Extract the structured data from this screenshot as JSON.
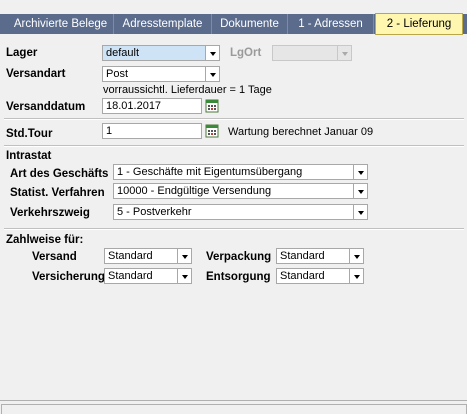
{
  "tabs": [
    {
      "label": "Archivierte Belege"
    },
    {
      "label": "Adresstemplate"
    },
    {
      "label": "Dokumente"
    },
    {
      "label": "1 - Adressen"
    },
    {
      "label": "2 - Lieferung",
      "active": true
    }
  ],
  "form": {
    "lager": {
      "label": "Lager",
      "value": "default"
    },
    "lgort": {
      "label": "LgOrt",
      "value": ""
    },
    "versandart": {
      "label": "Versandart",
      "value": "Post",
      "note": "vorraussichtl. Lieferdauer = 1 Tage"
    },
    "versanddatum": {
      "label": "Versanddatum",
      "value": "18.01.2017"
    },
    "stdtour": {
      "label": "Std.Tour",
      "value": "1",
      "note": "Wartung berechnet Januar 09"
    }
  },
  "intrastat": {
    "heading": "Intrastat",
    "art": {
      "label": "Art des Geschäfts",
      "value": "1 - Geschäfte mit Eigentumsübergang"
    },
    "verfahren": {
      "label": "Statist. Verfahren",
      "value": "10000 - Endgültige Versendung"
    },
    "verkehrszweig": {
      "label": "Verkehrszweig",
      "value": "5 - Postverkehr"
    }
  },
  "zahlweise": {
    "heading": "Zahlweise für:",
    "versand": {
      "label": "Versand",
      "value": "Standard"
    },
    "verpackung": {
      "label": "Verpackung",
      "value": "Standard"
    },
    "versicherung": {
      "label": "Versicherung",
      "value": "Standard"
    },
    "entsorgung": {
      "label": "Entsorgung",
      "value": "Standard"
    }
  },
  "icons": {
    "calendar": "calendar-icon",
    "dropdown": "chevron-down-icon"
  }
}
